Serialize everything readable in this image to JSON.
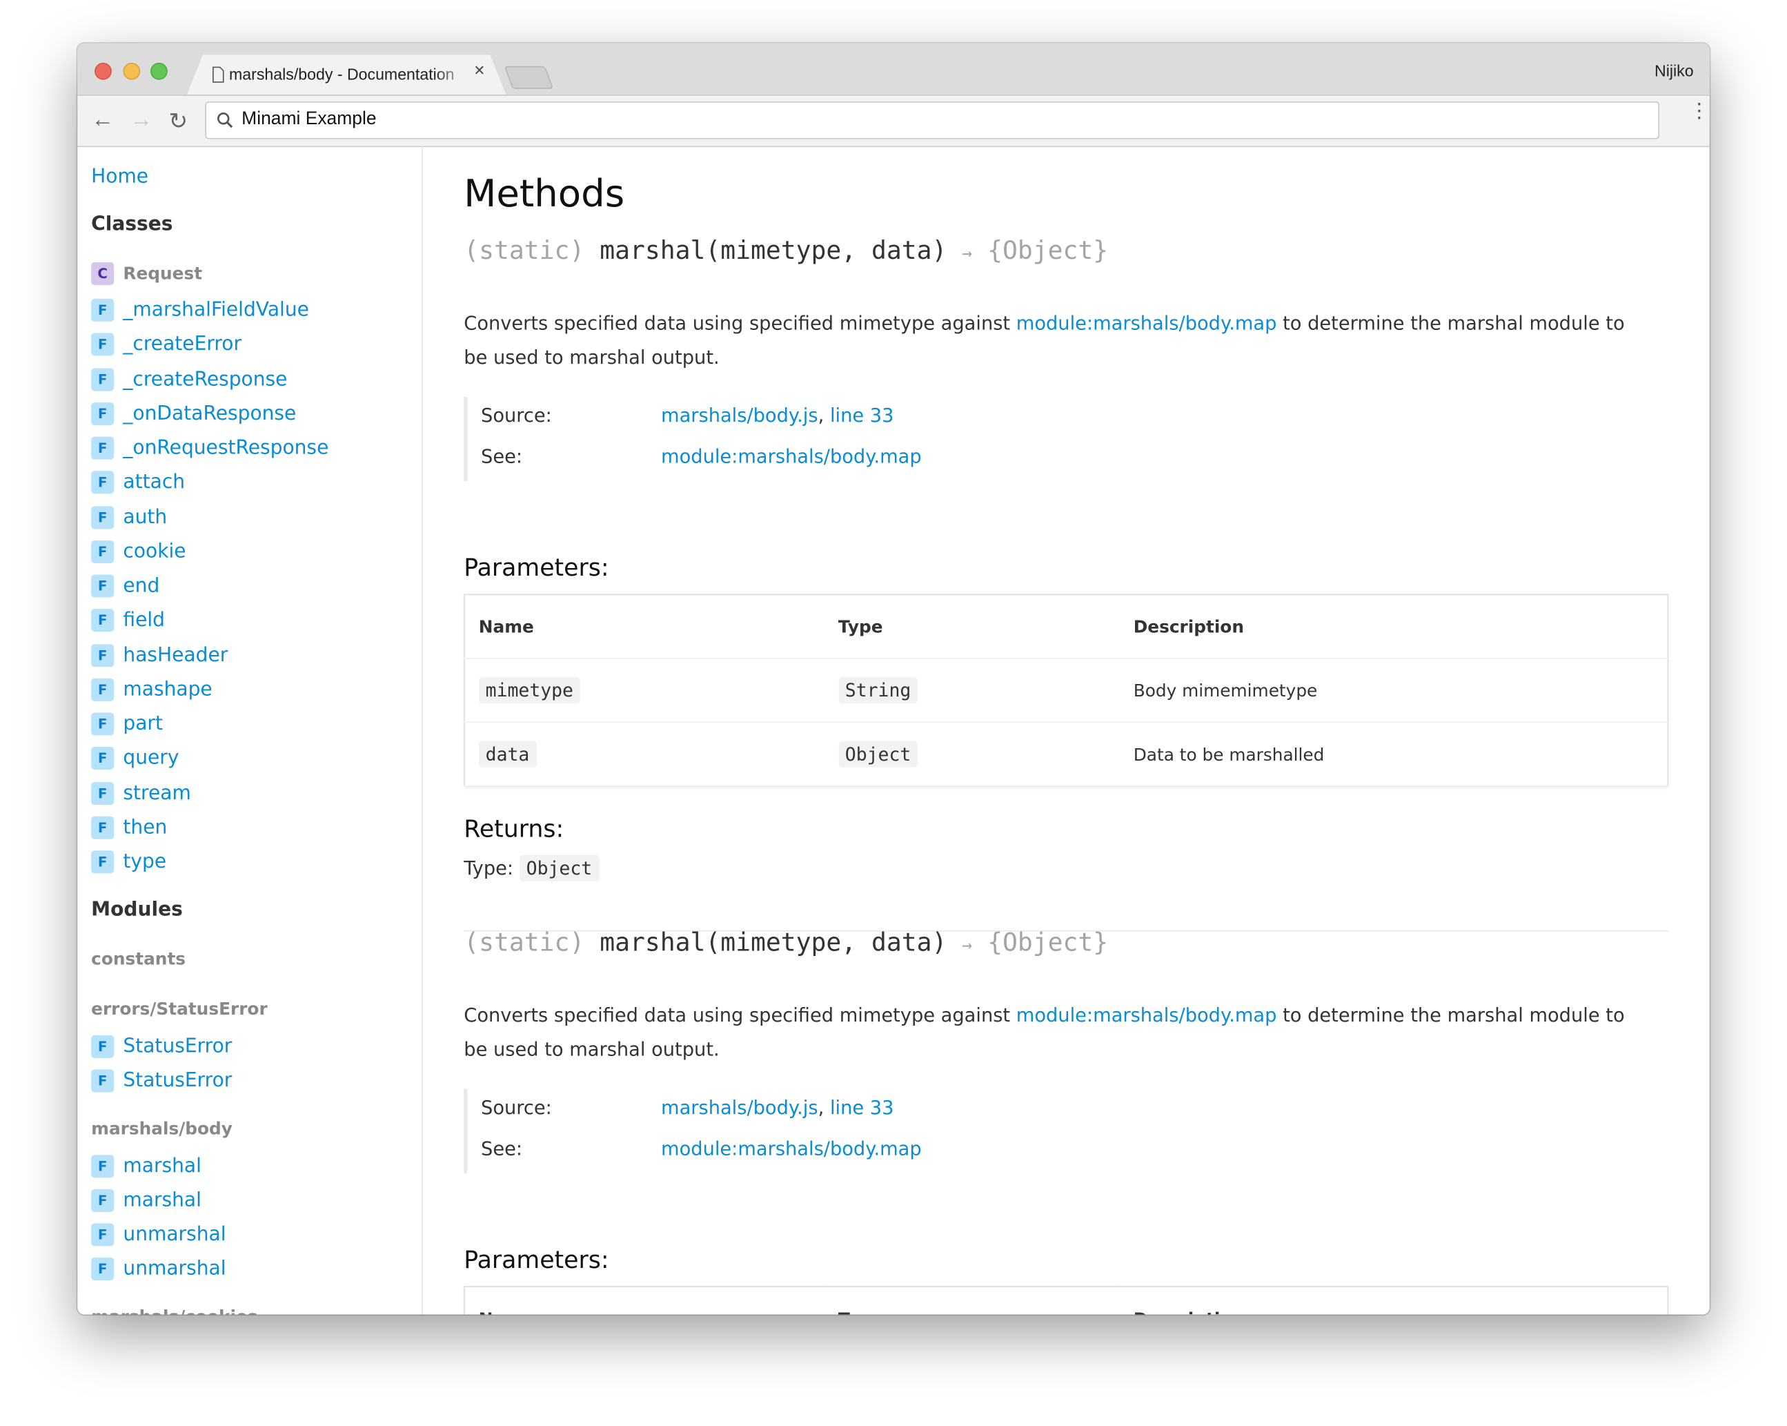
{
  "browser": {
    "tab_title": "marshals/body - Documentation",
    "user": "Nijiko",
    "address": "Minami Example"
  },
  "sidebar": {
    "home": "Home",
    "classes_heading": "Classes",
    "class": {
      "badge": "C",
      "label": "Request"
    },
    "class_functions": [
      "_marshalFieldValue",
      "_createError",
      "_createResponse",
      "_onDataResponse",
      "_onRequestResponse",
      "attach",
      "auth",
      "cookie",
      "end",
      "field",
      "hasHeader",
      "mashape",
      "part",
      "query",
      "stream",
      "then",
      "type"
    ],
    "badge_f": "F",
    "modules_heading": "Modules",
    "modules": [
      {
        "name": "constants",
        "items": []
      },
      {
        "name": "errors/StatusError",
        "items": [
          "StatusError",
          "StatusError"
        ]
      },
      {
        "name": "marshals/body",
        "items": [
          "marshal",
          "marshal",
          "unmarshal",
          "unmarshal"
        ]
      },
      {
        "name": "marshals/cookies",
        "items": []
      }
    ]
  },
  "main": {
    "title": "Methods",
    "methods": [
      {
        "static": "(static)",
        "name": "marshal(mimetype, data)",
        "arrow": "→",
        "returns": "{Object}",
        "desc_before": "Converts specified data using specified mimetype against ",
        "desc_link": "module:marshals/body.map",
        "desc_after": " to determine the marshal module to be used to marshal output.",
        "source_label": "Source:",
        "source_file": "marshals/body.js",
        "source_sep": ", ",
        "source_line": "line 33",
        "see_label": "See:",
        "see_link": "module:marshals/body.map",
        "params_heading": "Parameters:",
        "columns": [
          "Name",
          "Type",
          "Description"
        ],
        "params": [
          {
            "name": "mimetype",
            "type": "String",
            "description": "Body mimemimetype"
          },
          {
            "name": "data",
            "type": "Object",
            "description": "Data to be marshalled"
          }
        ],
        "returns_heading": "Returns:",
        "returns_type_label": "Type:",
        "returns_type": "Object"
      },
      {
        "static": "(static)",
        "name": "marshal(mimetype, data)",
        "arrow": "→",
        "returns": "{Object}",
        "desc_before": "Converts specified data using specified mimetype against ",
        "desc_link": "module:marshals/body.map",
        "desc_after": " to determine the marshal module to be used to marshal output.",
        "source_label": "Source:",
        "source_file": "marshals/body.js",
        "source_sep": ", ",
        "source_line": "line 33",
        "see_label": "See:",
        "see_link": "module:marshals/body.map",
        "params_heading": "Parameters:",
        "columns": [
          "Name",
          "Type",
          "Description"
        ]
      }
    ]
  }
}
